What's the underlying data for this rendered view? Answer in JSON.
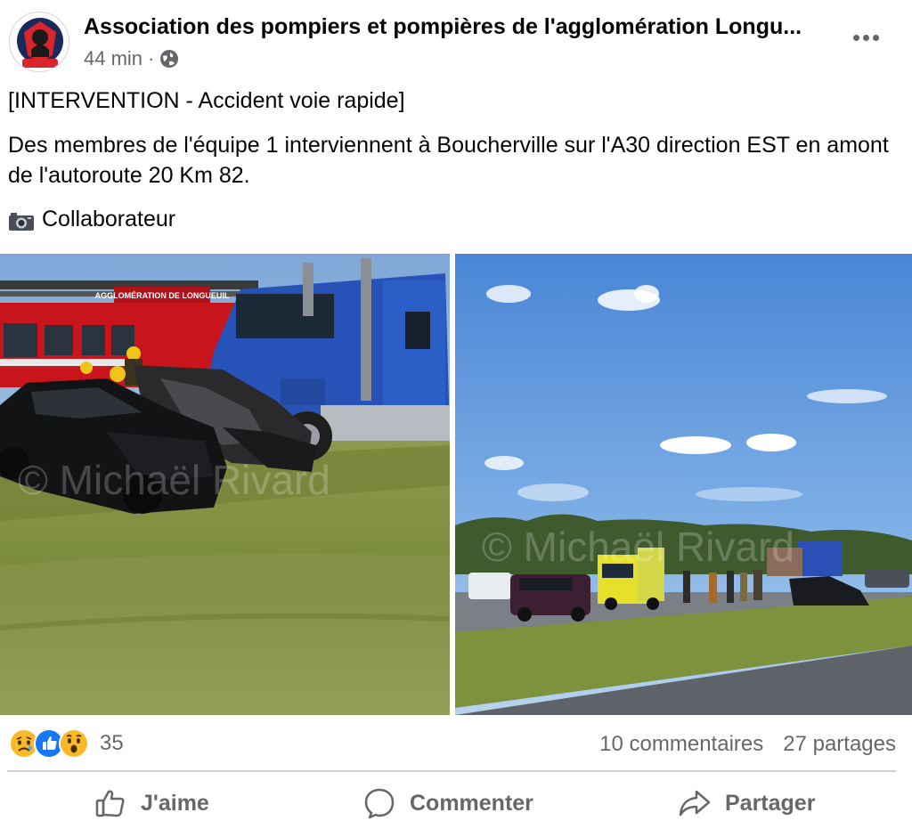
{
  "post": {
    "page_name": "Association des pompiers et pompières de l'agglomération Longu...",
    "time": "44 min",
    "separator": "·",
    "privacy_icon": "globe-icon",
    "text": {
      "line1": "[INTERVENTION - Accident voie rapide]",
      "line2": "Des membres de l'équipe 1 interviennent à Boucherville sur l'A30 direction EST en amont de l'autoroute 20 Km 82.",
      "line3": "Collaborateur"
    },
    "photo_truck_sign": "AGGLOMÉRATION DE LONGUEUIL",
    "watermark": "© Michaël Rivard"
  },
  "stats": {
    "reaction_icons": [
      "sad-icon",
      "like-icon",
      "wow-icon"
    ],
    "reaction_count": "35",
    "comments": "10 commentaires",
    "shares": "27 partages"
  },
  "actions": {
    "like": "J'aime",
    "comment": "Commenter",
    "share": "Partager"
  },
  "colors": {
    "like_blue": "#1877f2",
    "reaction_yellow": "#f7b928",
    "muted_text": "#65676b"
  }
}
